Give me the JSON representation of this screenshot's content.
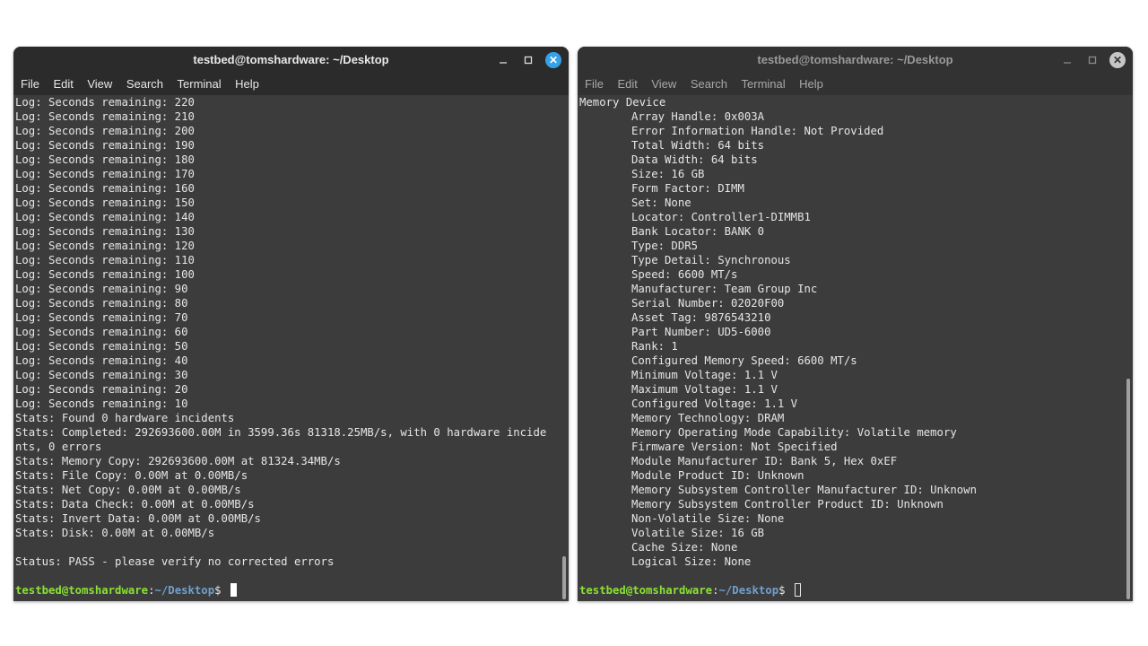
{
  "left_window": {
    "title": "testbed@tomshardware: ~/Desktop",
    "menu": [
      "File",
      "Edit",
      "View",
      "Search",
      "Terminal",
      "Help"
    ],
    "close_glyph": "✕",
    "lines": [
      "Log: Seconds remaining: 220",
      "Log: Seconds remaining: 210",
      "Log: Seconds remaining: 200",
      "Log: Seconds remaining: 190",
      "Log: Seconds remaining: 180",
      "Log: Seconds remaining: 170",
      "Log: Seconds remaining: 160",
      "Log: Seconds remaining: 150",
      "Log: Seconds remaining: 140",
      "Log: Seconds remaining: 130",
      "Log: Seconds remaining: 120",
      "Log: Seconds remaining: 110",
      "Log: Seconds remaining: 100",
      "Log: Seconds remaining: 90",
      "Log: Seconds remaining: 80",
      "Log: Seconds remaining: 70",
      "Log: Seconds remaining: 60",
      "Log: Seconds remaining: 50",
      "Log: Seconds remaining: 40",
      "Log: Seconds remaining: 30",
      "Log: Seconds remaining: 20",
      "Log: Seconds remaining: 10",
      "Stats: Found 0 hardware incidents",
      "Stats: Completed: 292693600.00M in 3599.36s 81318.25MB/s, with 0 hardware incide",
      "nts, 0 errors",
      "Stats: Memory Copy: 292693600.00M at 81324.34MB/s",
      "Stats: File Copy: 0.00M at 0.00MB/s",
      "Stats: Net Copy: 0.00M at 0.00MB/s",
      "Stats: Data Check: 0.00M at 0.00MB/s",
      "Stats: Invert Data: 0.00M at 0.00MB/s",
      "Stats: Disk: 0.00M at 0.00MB/s",
      "",
      "Status: PASS - please verify no corrected errors",
      ""
    ],
    "prompt": {
      "user": "testbed@tomshardware",
      "sep": ":",
      "path": "~/Desktop",
      "symbol": "$ "
    }
  },
  "right_window": {
    "title": "testbed@tomshardware: ~/Desktop",
    "menu": [
      "File",
      "Edit",
      "View",
      "Search",
      "Terminal",
      "Help"
    ],
    "close_glyph": "✕",
    "header": "Memory Device",
    "lines": [
      "Array Handle: 0x003A",
      "Error Information Handle: Not Provided",
      "Total Width: 64 bits",
      "Data Width: 64 bits",
      "Size: 16 GB",
      "Form Factor: DIMM",
      "Set: None",
      "Locator: Controller1-DIMMB1",
      "Bank Locator: BANK 0",
      "Type: DDR5",
      "Type Detail: Synchronous",
      "Speed: 6600 MT/s",
      "Manufacturer: Team Group Inc",
      "Serial Number: 02020F00",
      "Asset Tag: 9876543210",
      "Part Number: UD5-6000",
      "Rank: 1",
      "Configured Memory Speed: 6600 MT/s",
      "Minimum Voltage: 1.1 V",
      "Maximum Voltage: 1.1 V",
      "Configured Voltage: 1.1 V",
      "Memory Technology: DRAM",
      "Memory Operating Mode Capability: Volatile memory",
      "Firmware Version: Not Specified",
      "Module Manufacturer ID: Bank 5, Hex 0xEF",
      "Module Product ID: Unknown",
      "Memory Subsystem Controller Manufacturer ID: Unknown",
      "Memory Subsystem Controller Product ID: Unknown",
      "Non-Volatile Size: None",
      "Volatile Size: 16 GB",
      "Cache Size: None",
      "Logical Size: None",
      ""
    ],
    "prompt": {
      "user": "testbed@tomshardware",
      "sep": ":",
      "path": "~/Desktop",
      "symbol": "$ "
    }
  },
  "colors": {
    "terminal_bg": "#3c3c3c",
    "prompt_user": "#8ae234",
    "prompt_path": "#729fcf",
    "close_active": "#35a1e8"
  }
}
